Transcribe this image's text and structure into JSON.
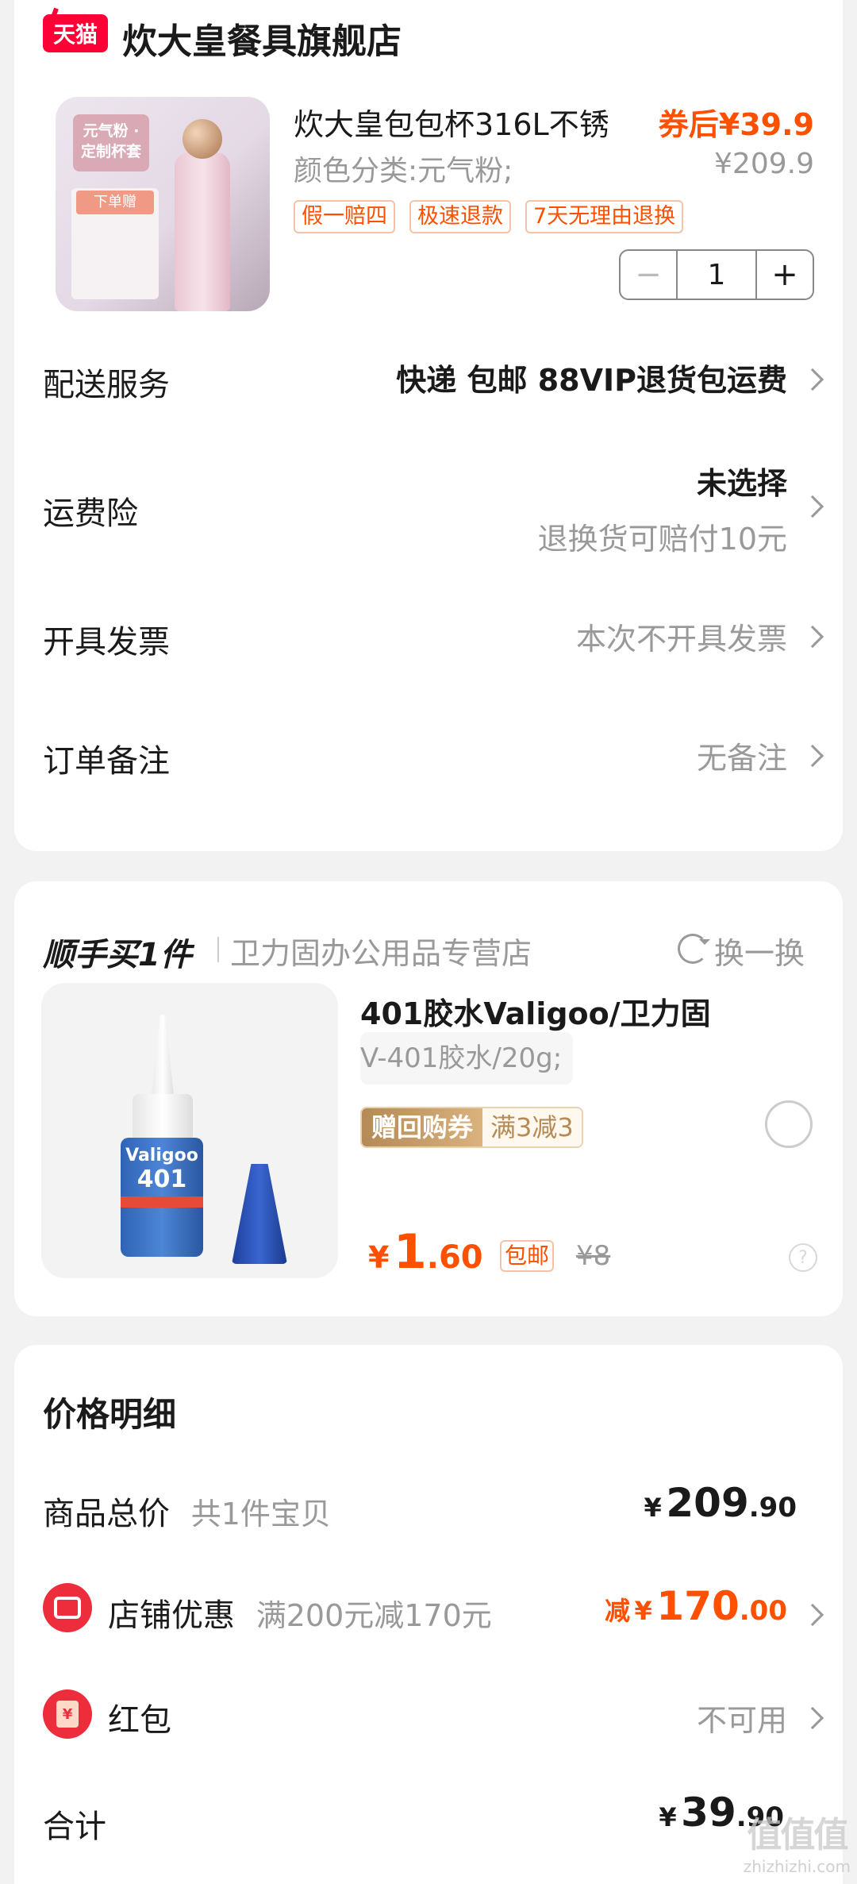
{
  "store": {
    "logo_text": "天猫",
    "name": "炊大皇餐具旗舰店"
  },
  "product": {
    "image_tag": "元气粉 ·定制杯套",
    "image_gift_label": "下单赠",
    "title": "炊大皇包包杯316L不锈",
    "price": "券后¥39.9",
    "spec": "颜色分类:元气粉;",
    "original_price": "¥209.9",
    "badges": [
      "假一赔四",
      "极速退款",
      "7天无理由退换"
    ],
    "quantity": "1",
    "minus_label": "−",
    "plus_label": "+"
  },
  "rows": {
    "delivery": {
      "label": "配送服务",
      "value": "快递 包邮 88VIP退货包运费"
    },
    "shipping_insurance": {
      "label": "运费险",
      "value": "未选择",
      "sub": "退换货可赔付10元"
    },
    "invoice": {
      "label": "开具发票",
      "value": "本次不开具发票"
    },
    "note": {
      "label": "订单备注",
      "value": "无备注"
    }
  },
  "add_on": {
    "title": "顺手买1件",
    "store": "卫力固办公用品专营店",
    "swap_label": "换一换",
    "image_brand": "Valigoo",
    "image_model": "401",
    "item_title": "401胶水Valigoo/卫力固",
    "item_spec": "V-401胶水/20g;",
    "coupon_left": "赠回购券",
    "coupon_right": "满3减3",
    "price_currency": "¥",
    "price_int": "1",
    "price_dec": ".60",
    "free_ship": "包邮",
    "original_price": "¥8",
    "help_icon": "?"
  },
  "price_detail": {
    "title": "价格明细",
    "total": {
      "label": "商品总价",
      "sub": "共1件宝贝",
      "currency": "¥",
      "int": "209",
      "dec": ".90"
    },
    "store_discount": {
      "label": "店铺优惠",
      "sub": "满200元减170元",
      "prefix": "减",
      "currency": "¥",
      "int": "170",
      "dec": ".00"
    },
    "red_packet": {
      "label": "红包",
      "value": "不可用",
      "icon_text": "¥"
    },
    "sum": {
      "label": "合计",
      "currency": "¥",
      "int": "39",
      "dec": ".90"
    }
  },
  "watermark": {
    "big": "值值值",
    "small": "zhizhizhi.com"
  },
  "colors": {
    "accent": "#ff5000",
    "tmall_red": "#ff0036",
    "muted": "#999999",
    "background": "#f2f2f2"
  }
}
